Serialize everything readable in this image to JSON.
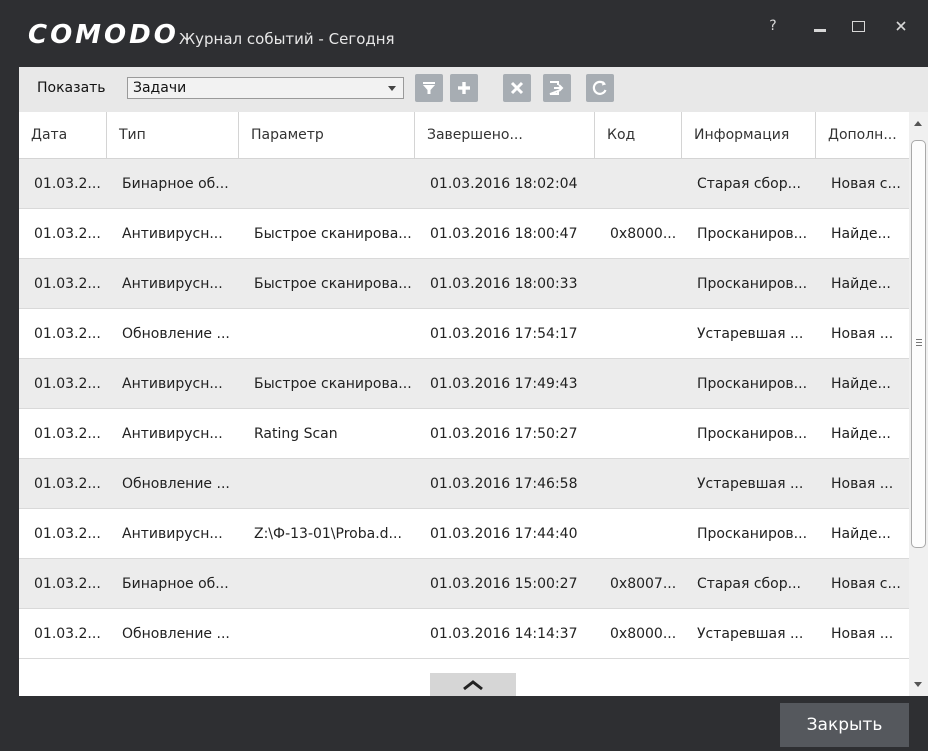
{
  "window": {
    "brand": "COMODO",
    "title": "Журнал событий - Сегодня",
    "help_label": "?"
  },
  "toolbar": {
    "show_label": "Показать",
    "filter_value": "Задачи",
    "icons": [
      "filter-icon",
      "plus-icon",
      "delete-icon",
      "export-icon",
      "refresh-icon"
    ]
  },
  "table": {
    "columns": [
      "Дата",
      "Тип",
      "Параметр",
      "Завершено...",
      "Код",
      "Информация",
      "Дополн..."
    ],
    "rows": [
      [
        "01.03.2...",
        "Бинарное об...",
        "",
        "01.03.2016 18:02:04",
        "",
        "Старая сбор...",
        "Новая с..."
      ],
      [
        "01.03.2...",
        "Антивирусн...",
        "Быстрое сканирова...",
        "01.03.2016 18:00:47",
        "0x8000...",
        "Просканиров...",
        "Найде..."
      ],
      [
        "01.03.2...",
        "Антивирусн...",
        "Быстрое сканирова...",
        "01.03.2016 18:00:33",
        "",
        "Просканиров...",
        "Найде..."
      ],
      [
        "01.03.2...",
        "Обновление ...",
        "",
        "01.03.2016 17:54:17",
        "",
        "Устаревшая ...",
        "Новая ..."
      ],
      [
        "01.03.2...",
        "Антивирусн...",
        "Быстрое сканирова...",
        "01.03.2016 17:49:43",
        "",
        "Просканиров...",
        "Найде..."
      ],
      [
        "01.03.2...",
        "Антивирусн...",
        "Rating Scan",
        "01.03.2016 17:50:27",
        "",
        "Просканиров...",
        "Найде..."
      ],
      [
        "01.03.2...",
        "Обновление ...",
        "",
        "01.03.2016 17:46:58",
        "",
        "Устаревшая ...",
        "Новая ..."
      ],
      [
        "01.03.2...",
        "Антивирусн...",
        "Z:\\Ф-13-01\\Proba.d...",
        "01.03.2016 17:44:40",
        "",
        "Просканиров...",
        "Найде..."
      ],
      [
        "01.03.2...",
        "Бинарное об...",
        "",
        "01.03.2016 15:00:27",
        "0x8007...",
        "Старая сбор...",
        "Новая с..."
      ],
      [
        "01.03.2...",
        "Обновление ...",
        "",
        "01.03.2016 14:14:37",
        "0x8000...",
        "Устаревшая ...",
        "Новая ..."
      ]
    ]
  },
  "footer": {
    "close_label": "Закрыть"
  },
  "colors": {
    "window_bg": "#2e2f32",
    "toolbar_bg": "#e8e8e8",
    "icon_button": "#a7adb3",
    "row_alt": "#ececec",
    "close_button": "#55585d"
  }
}
